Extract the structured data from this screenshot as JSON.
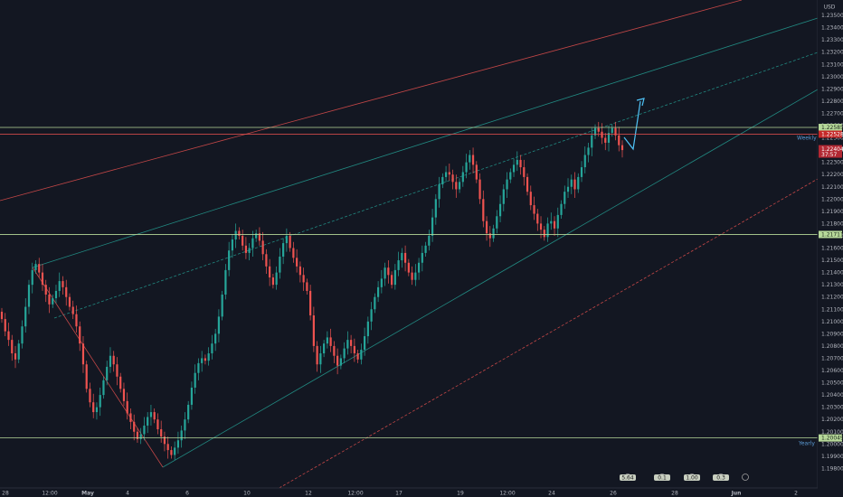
{
  "chart_data": {
    "type": "candlestick",
    "symbol_currency": "USD",
    "y_axis": {
      "ylim": [
        1.1979,
        1.2369
      ],
      "ticks": [
        "1.23600",
        "1.23500",
        "1.23400",
        "1.23300",
        "1.23200",
        "1.23100",
        "1.23000",
        "1.22900",
        "1.22800",
        "1.22700",
        "1.22600",
        "1.22500",
        "1.22400",
        "1.22300",
        "1.22200",
        "1.22100",
        "1.22000",
        "1.21900",
        "1.21800",
        "1.21700",
        "1.21600",
        "1.21500",
        "1.21400",
        "1.21300",
        "1.21200",
        "1.21100",
        "1.21000",
        "1.20900",
        "1.20800",
        "1.20700",
        "1.20600",
        "1.20500",
        "1.20400",
        "1.20300",
        "1.20200",
        "1.20100",
        "1.20000",
        "1.19900",
        "1.19800"
      ]
    },
    "x_axis": {
      "ticks": [
        "28",
        "12:00",
        "May",
        "4",
        "6",
        "10",
        "12",
        "12:00",
        "17",
        "19",
        "12:00",
        "24",
        "26",
        "28",
        "Jun",
        "2"
      ]
    },
    "horizontal_levels": [
      {
        "label_text": "1.22585",
        "value": 1.22585,
        "color": "#b7d99a"
      },
      {
        "label_text": "1.22528",
        "value": 1.2253,
        "color": "#ef5350"
      },
      {
        "label_text": "1.21711",
        "value": 1.21711,
        "color": "#b7d99a"
      },
      {
        "label_text": "1.20049",
        "value": 1.20049,
        "color": "#b7d99a",
        "side_label": "Yearly"
      }
    ],
    "level_labels": {
      "weekly": "Weekly"
    },
    "price_tag": {
      "price": "1.22404",
      "countdown": "37:57",
      "color": "#b22833"
    },
    "candles_close": [
      1.2102,
      1.2092,
      1.2085,
      1.2074,
      1.2069,
      1.2082,
      1.2096,
      1.2112,
      1.213,
      1.2142,
      1.2147,
      1.214,
      1.213,
      1.2122,
      1.2114,
      1.2119,
      1.2125,
      1.2133,
      1.2128,
      1.212,
      1.2112,
      1.2106,
      1.2096,
      1.2082,
      1.2065,
      1.2045,
      1.2034,
      1.2026,
      1.203,
      1.204,
      1.2052,
      1.2063,
      1.2072,
      1.2065,
      1.2055,
      1.2045,
      1.2035,
      1.2025,
      1.2018,
      1.201,
      1.2004,
      1.2008,
      1.2015,
      1.2022,
      1.2026,
      1.202,
      1.2012,
      1.2006,
      1.2,
      1.1995,
      1.1991,
      1.1997,
      1.2003,
      1.2011,
      1.202,
      1.2032,
      1.2046,
      1.2058,
      1.2066,
      1.207,
      1.2068,
      1.2074,
      1.2082,
      1.209,
      1.2104,
      1.2122,
      1.2142,
      1.2158,
      1.2167,
      1.2174,
      1.217,
      1.2162,
      1.2156,
      1.216,
      1.2168,
      1.2172,
      1.2166,
      1.2155,
      1.2145,
      1.2136,
      1.213,
      1.214,
      1.2153,
      1.2164,
      1.217,
      1.216,
      1.2152,
      1.2145,
      1.2138,
      1.2132,
      1.2125,
      1.2105,
      1.208,
      1.2065,
      1.2074,
      1.2082,
      1.2087,
      1.208,
      1.2072,
      1.2064,
      1.207,
      1.2078,
      1.2085,
      1.208,
      1.2074,
      1.2069,
      1.2077,
      1.2088,
      1.21,
      1.211,
      1.212,
      1.2128,
      1.2135,
      1.2144,
      1.2138,
      1.213,
      1.2142,
      1.215,
      1.2156,
      1.2148,
      1.214,
      1.2134,
      1.214,
      1.2148,
      1.2156,
      1.2162,
      1.217,
      1.2185,
      1.22,
      1.2212,
      1.2218,
      1.2222,
      1.222,
      1.2214,
      1.2208,
      1.2214,
      1.2222,
      1.223,
      1.2236,
      1.2228,
      1.2216,
      1.22,
      1.2182,
      1.2172,
      1.2168,
      1.2176,
      1.2186,
      1.2196,
      1.2208,
      1.2216,
      1.2222,
      1.2228,
      1.2232,
      1.2226,
      1.2218,
      1.2206,
      1.2195,
      1.2188,
      1.218,
      1.2175,
      1.2169,
      1.218,
      1.2182,
      1.2176,
      1.2187,
      1.2196,
      1.2206,
      1.221,
      1.2216,
      1.2208,
      1.2218,
      1.2226,
      1.2236,
      1.2242,
      1.2252,
      1.2258,
      1.2255,
      1.225,
      1.2246,
      1.2254,
      1.2258,
      1.2252,
      1.2244,
      1.224
    ],
    "channel_lines": [
      {
        "color": "#ef5350",
        "style": "solid"
      },
      {
        "color": "#26a69a",
        "style": "solid"
      },
      {
        "color": "#26a69a",
        "style": "dashed"
      },
      {
        "color": "#26a69a",
        "style": "solid"
      },
      {
        "color": "#ef5350",
        "style": "dashed"
      }
    ],
    "bottom_badges": [
      "5.64",
      "0.1",
      "1.00",
      "0.3",
      ""
    ],
    "colors": {
      "background": "#131722",
      "up": "#26a69a",
      "down": "#ef5350",
      "text": "#b2b5be",
      "arrow": "#4fc3f7"
    }
  }
}
